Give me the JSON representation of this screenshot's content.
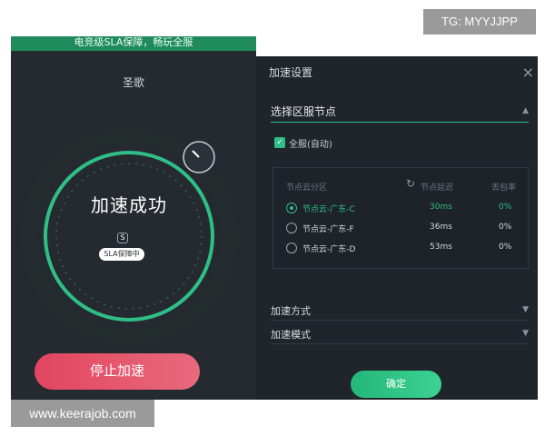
{
  "watermark_top": "TG: MYYJJPP",
  "watermark_bottom": "www.keerajob.com",
  "left_panel": {
    "banner": "电竞级SLA保障，畅玩全服",
    "game_title": "圣歌",
    "status": "加速成功",
    "sla_icon_glyph": "S",
    "sla_badge": "SLA保障中",
    "stop_button": "停止加速",
    "colors": {
      "ring": "#2fbf86",
      "stop_button": "#e2455f",
      "background": "#252a31"
    }
  },
  "settings": {
    "title": "加速设置",
    "close_glyph": "×",
    "region_section": {
      "title": "选择区服节点",
      "collapse_glyph": "▲",
      "checkbox_label": "全服(自动)",
      "checkbox_checked": true,
      "checkbox_glyph": "✓",
      "table_headers": {
        "node": "节点云分区",
        "latency": "节点延迟",
        "loss": "丢包率"
      },
      "refresh_glyph": "↻",
      "nodes": [
        {
          "name": "节点云-广东-C",
          "latency": "30ms",
          "loss": "0%",
          "selected": true
        },
        {
          "name": "节点云-广东-F",
          "latency": "36ms",
          "loss": "0%",
          "selected": false
        },
        {
          "name": "节点云-广东-D",
          "latency": "53ms",
          "loss": "0%",
          "selected": false
        }
      ]
    },
    "options": [
      {
        "label": "加速方式",
        "arrow": "▼"
      },
      {
        "label": "加速模式",
        "arrow": "▼"
      }
    ],
    "confirm_button": "确定",
    "accent_color": "#2fbf86"
  }
}
